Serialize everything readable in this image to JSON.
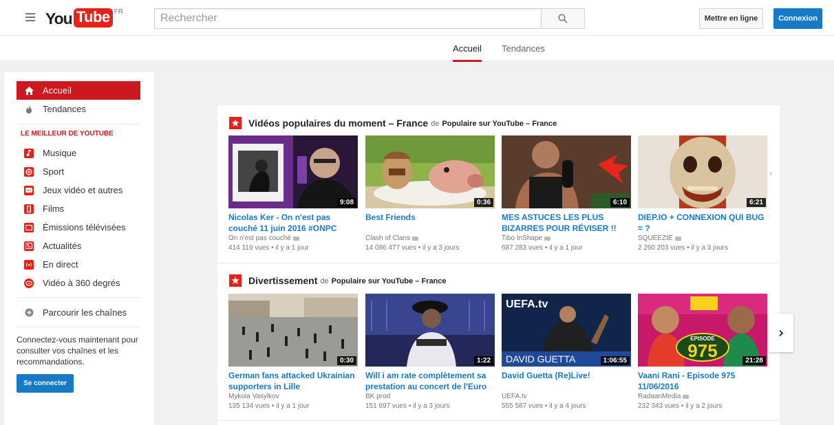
{
  "header": {
    "logo_you": "You",
    "logo_tube": "Tube",
    "logo_country": "FR",
    "search_placeholder": "Rechercher",
    "upload_label": "Mettre en ligne",
    "login_label": "Connexion"
  },
  "tabs": [
    {
      "label": "Accueil",
      "active": true
    },
    {
      "label": "Tendances",
      "active": false
    }
  ],
  "sidebar": {
    "top_items": [
      {
        "label": "Accueil",
        "icon": "home-icon",
        "active": true
      },
      {
        "label": "Tendances",
        "icon": "flame-icon",
        "active": false
      }
    ],
    "section_title": "LE MEILLEUR DE YOUTUBE",
    "best_items": [
      {
        "label": "Musique",
        "icon": "music-icon"
      },
      {
        "label": "Sport",
        "icon": "sport-icon"
      },
      {
        "label": "Jeux vidéo et autres",
        "icon": "gamepad-icon"
      },
      {
        "label": "Films",
        "icon": "film-icon"
      },
      {
        "label": "Émissions télévisées",
        "icon": "tv-icon"
      },
      {
        "label": "Actualités",
        "icon": "news-icon"
      },
      {
        "label": "En direct",
        "icon": "live-icon"
      },
      {
        "label": "Vidéo à 360 degrés",
        "icon": "360-icon"
      }
    ],
    "browse_label": "Parcourir les chaînes",
    "signin_message": "Connectez-vous maintenant pour consulter vos chaînes et les recommandations.",
    "signin_button": "Se connecter"
  },
  "shelves": [
    {
      "title": "Vidéos populaires du moment – France",
      "de": "de",
      "source": "Populaire sur YouTube – France",
      "videos": [
        {
          "title": "Nicolas Ker - On n'est pas couché 11 juin 2016 #ONPC",
          "channel": "On n'est pas couché",
          "verified": true,
          "views": "414 119 vues",
          "age": "il y a 1 jour",
          "duration": "9:08"
        },
        {
          "title": "Best Friends",
          "channel": "Clash of Clans",
          "verified": true,
          "views": "14 086 477 vues",
          "age": "il y a 3 jours",
          "duration": "0:36"
        },
        {
          "title": "MES ASTUCES LES PLUS BIZARRES POUR RÉVISER !!",
          "channel": "Tibo InShape",
          "verified": true,
          "views": "687 283 vues",
          "age": "il y a 1 jour",
          "duration": "6:10"
        },
        {
          "title": "DIEP.IO + CONNEXION QUI BUG = ?",
          "channel": "SQUEEZIE",
          "verified": true,
          "views": "2 260 203 vues",
          "age": "il y a 3 jours",
          "duration": "6:21"
        }
      ]
    },
    {
      "title": "Divertissement",
      "de": "de",
      "source": "Populaire sur YouTube – France",
      "videos": [
        {
          "title": "German fans attacked Ukrainian supporters in Lille",
          "channel": "Mykola Vasylkov",
          "verified": false,
          "views": "135 134 vues",
          "age": "il y a 1 jour",
          "duration": "0:30"
        },
        {
          "title": "Will i am rate complètement sa prestation au concert de l'Euro",
          "channel": "BK prod",
          "verified": false,
          "views": "151 697 vues",
          "age": "il y a 3 jours",
          "duration": "1:22"
        },
        {
          "title": "David Guetta (Re)Live!",
          "channel": "UEFA.tv",
          "verified": false,
          "views": "555 587 vues",
          "age": "il y a 4 jours",
          "duration": "1:06:55"
        },
        {
          "title": "Vaani Rani - Episode 975 11/06/2016",
          "channel": "RadaanMedia",
          "verified": true,
          "views": "232 343 vues",
          "age": "il y a 2 jours",
          "duration": "21:28"
        }
      ]
    }
  ],
  "thumb_text": {
    "uefa": "UEFA.tv",
    "guetta": "DAVID GUETTA",
    "episode": "EPISODE",
    "episode_num": "975"
  },
  "bullet": "•",
  "colors": {
    "brand_red": "#e62117",
    "link_blue": "#167ac6",
    "active_red": "#cc181e"
  }
}
